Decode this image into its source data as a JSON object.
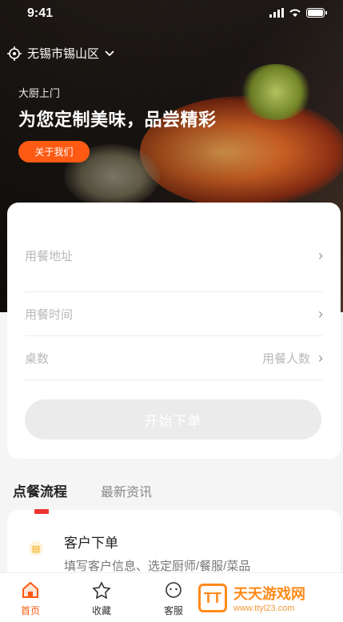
{
  "status": {
    "time": "9:41"
  },
  "location": {
    "city": "无锡市锡山区"
  },
  "hero": {
    "tag": "大厨上门",
    "headline": "为您定制美味，品尝精彩",
    "about_label": "关于我们"
  },
  "form": {
    "address_placeholder": "用餐地址",
    "time_placeholder": "用餐时间",
    "tables_label": "桌数",
    "guests_placeholder": "用餐人数",
    "submit_label": "开始下单"
  },
  "section_tabs": [
    "点餐流程",
    "最新资讯"
  ],
  "flow": {
    "title": "客户下单",
    "desc": "填写客户信息、选定厨师/餐服/菜品"
  },
  "tabbar": {
    "items": [
      {
        "label": "首页",
        "icon": "home-icon"
      },
      {
        "label": "收藏",
        "icon": "star-icon"
      },
      {
        "label": "客服",
        "icon": "service-icon"
      }
    ]
  },
  "watermark": {
    "name": "天天游戏网",
    "url": "www.ttyl23.com"
  },
  "colors": {
    "accent": "#ff5a14",
    "divider": "#ededed"
  }
}
